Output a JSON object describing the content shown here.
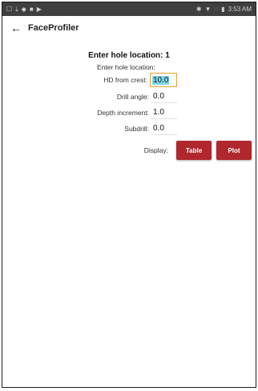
{
  "status_bar": {
    "left_icons": [
      "☐",
      "⤓",
      "◆",
      "■",
      "▶"
    ],
    "right_icons": [
      "✱",
      "▼",
      "◌",
      "▮"
    ],
    "time": "3:53 AM"
  },
  "app_bar": {
    "title": "FaceProfiler",
    "back_icon": "←"
  },
  "form": {
    "heading": "Enter hole location: 1",
    "subheading": "Enter hole location:",
    "fields": [
      {
        "label": "HD from crest:",
        "value": "10.0"
      },
      {
        "label": "Drill angle:",
        "value": "0.0"
      },
      {
        "label": "Depth increment:",
        "value": "1.0"
      },
      {
        "label": "Subdrill:",
        "value": "0.0"
      }
    ]
  },
  "display": {
    "label": "Display:",
    "buttons": [
      "Table",
      "Plot"
    ]
  },
  "colors": {
    "accent": "#b0282e",
    "focus_border": "#e0a030",
    "selection": "#7fd7e8"
  }
}
